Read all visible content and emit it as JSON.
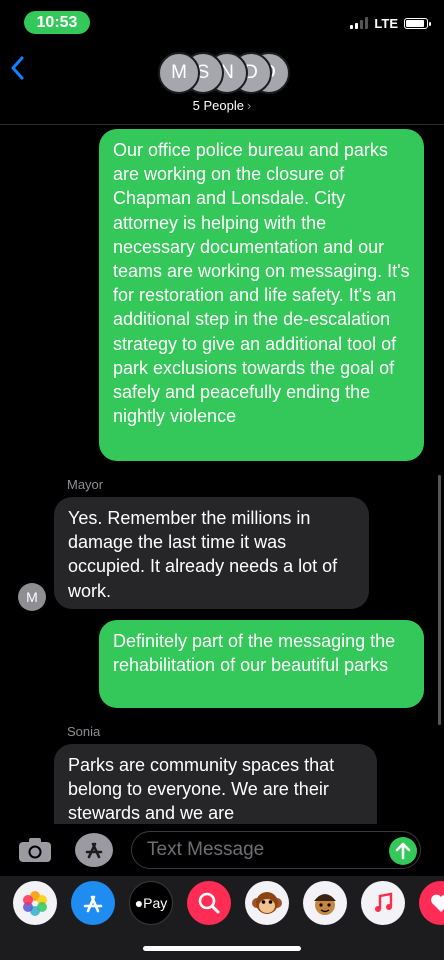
{
  "status_bar": {
    "time": "10:53",
    "network": "LTE",
    "battery_level": 0.9,
    "signal_bars": 2
  },
  "header": {
    "avatars": [
      "M",
      "S",
      "N",
      "D",
      "D"
    ],
    "group_label": "5 People",
    "chevron": "›"
  },
  "messages": [
    {
      "direction": "outgoing",
      "text": "Our office police bureau and parks are working on the closure of Chapman and Lonsdale. City attorney is helping with the necessary documentation and our teams are working on messaging. It's for restoration and life safety.  It's an additional step in the de-escalation strategy to give an additional tool of park exclusions towards the goal of safely and peacefully ending the nightly violence"
    },
    {
      "direction": "incoming",
      "sender": "Mayor",
      "avatar": "M",
      "text": "Yes. Remember the millions in damage the last time it was occupied. It already needs a lot of work."
    },
    {
      "direction": "outgoing",
      "text": "Definitely part of the messaging the rehabilitation of our beautiful parks"
    },
    {
      "direction": "incoming",
      "sender": "Sonia",
      "text": "Parks are community spaces that belong to everyone. We are their stewards and we are"
    }
  ],
  "input_bar": {
    "placeholder": "Text Message",
    "icons": [
      "camera-icon",
      "app-store-icon",
      "send-arrow-icon"
    ]
  },
  "app_drawer": {
    "apps": [
      "photos-icon",
      "app-store-icon",
      "apple-pay-icon",
      "web-search-icon",
      "monkey-memoji-icon",
      "memoji-icon",
      "music-icon",
      "heart-icon"
    ],
    "apple_pay_label": "Pay"
  },
  "colors": {
    "outgoing_bubble": "#34c759",
    "incoming_bubble": "#262629",
    "accent": "#0a84ff"
  }
}
